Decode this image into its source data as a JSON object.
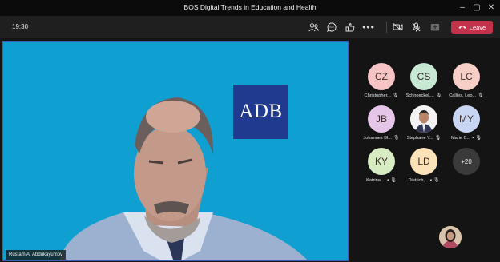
{
  "window": {
    "title": "BOS Digital Trends in Education and Health"
  },
  "toolbar": {
    "time": "19:30",
    "leave_label": "Leave"
  },
  "stage": {
    "logo_text": "ADB",
    "speaker_name": "Rustam A. Abdukayumov"
  },
  "participants": [
    {
      "initials": "CZ",
      "name": "Christopher...",
      "color": "#f6c4c4"
    },
    {
      "initials": "CS",
      "name": "Schnoeckel,...",
      "color": "#c7e8d3"
    },
    {
      "initials": "LC",
      "name": "Callies, Leo...",
      "color": "#f7cfc6"
    },
    {
      "initials": "JB",
      "name": "Johannes Bl...",
      "color": "#e6c6e8"
    },
    {
      "initials": "",
      "name": "Stephane Y...",
      "color": "#ffffff"
    },
    {
      "initials": "MY",
      "name": "Marie C...",
      "color": "#c8d6f3"
    },
    {
      "initials": "KY",
      "name": "Katrina ...",
      "color": "#d8ecc4"
    },
    {
      "initials": "LD",
      "name": "Dietrich,...",
      "color": "#fbe2b8"
    }
  ],
  "overflow": {
    "label": "+20"
  },
  "colors": {
    "stage_bg": "#0f9fd1",
    "logo_bg": "#1f3a8f",
    "leave_bg": "#c4314b"
  }
}
